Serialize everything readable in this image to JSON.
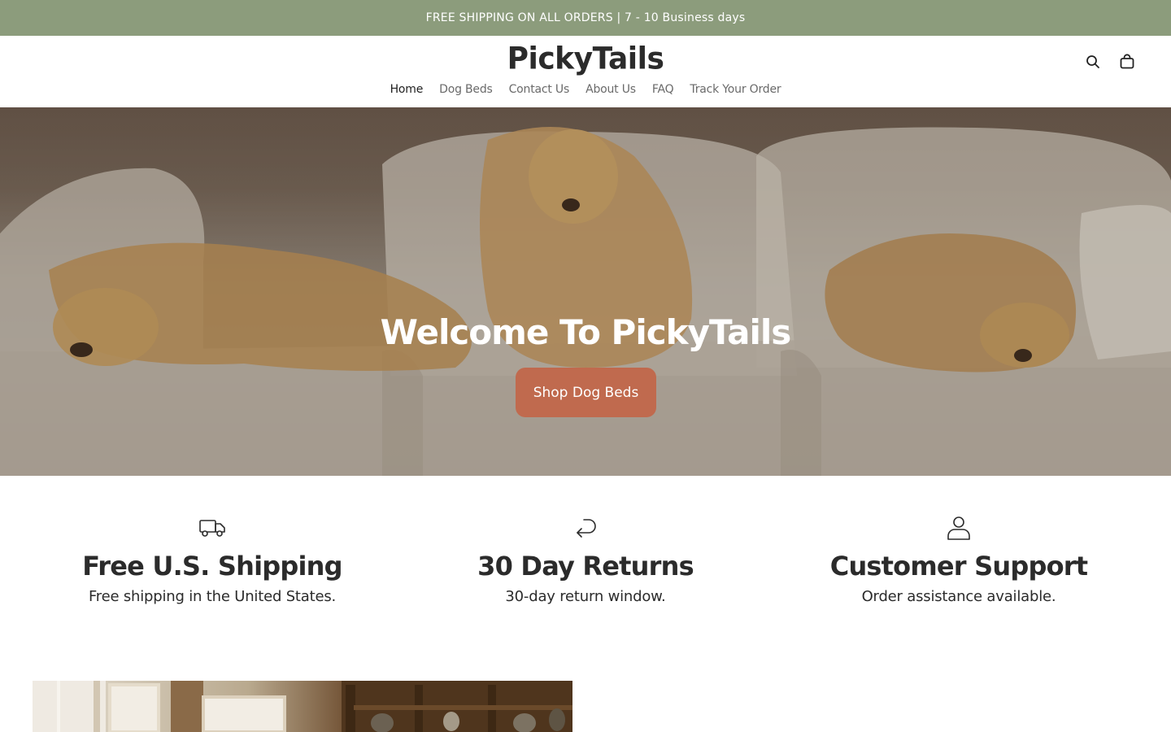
{
  "announcement": {
    "text": "FREE SHIPPING ON ALL ORDERS | 7 - 10 Business days"
  },
  "header": {
    "logo": "PickyTails",
    "icons": {
      "search": "search-icon",
      "cart": "cart-icon"
    }
  },
  "nav": {
    "items": [
      {
        "label": "Home",
        "active": true
      },
      {
        "label": "Dog Beds"
      },
      {
        "label": "Contact Us"
      },
      {
        "label": "About Us"
      },
      {
        "label": "FAQ"
      },
      {
        "label": "Track Your Order"
      }
    ]
  },
  "hero": {
    "title": "Welcome To PickyTails",
    "button_label": "Shop Dog Beds",
    "button_color": "#c06a4e"
  },
  "features": [
    {
      "icon": "truck-icon",
      "title": "Free U.S. Shipping",
      "text": "Free shipping in the United States."
    },
    {
      "icon": "return-arrow-icon",
      "title": "30 Day Returns",
      "text": "30-day return window."
    },
    {
      "icon": "person-icon",
      "title": "Customer Support",
      "text": "Order assistance available."
    }
  ],
  "colors": {
    "announcement_bg": "#8c9c7c",
    "accent": "#c06a4e",
    "text": "#2b2b2b"
  }
}
